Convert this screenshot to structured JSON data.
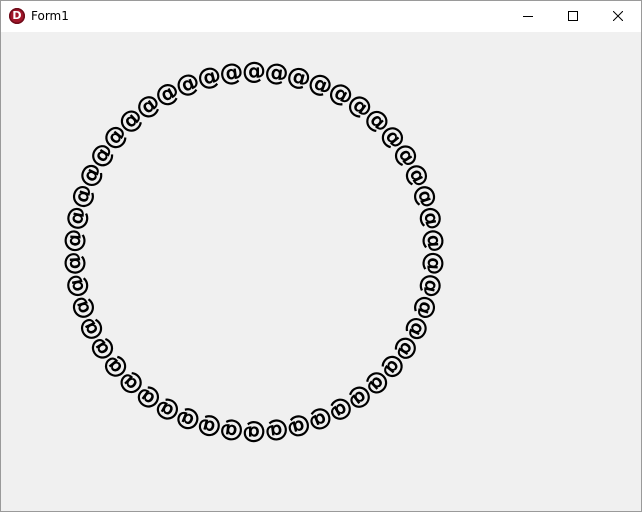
{
  "window": {
    "title": "Form1",
    "icon_letter": "D",
    "icon": "delphi-app-icon",
    "controls": [
      "minimize-icon",
      "maximize-icon",
      "close-icon"
    ]
  },
  "canvas": {
    "glyph": "@",
    "glyph_count": 50,
    "glyph_color": "#000000",
    "background_color": "#f0f0f0"
  }
}
